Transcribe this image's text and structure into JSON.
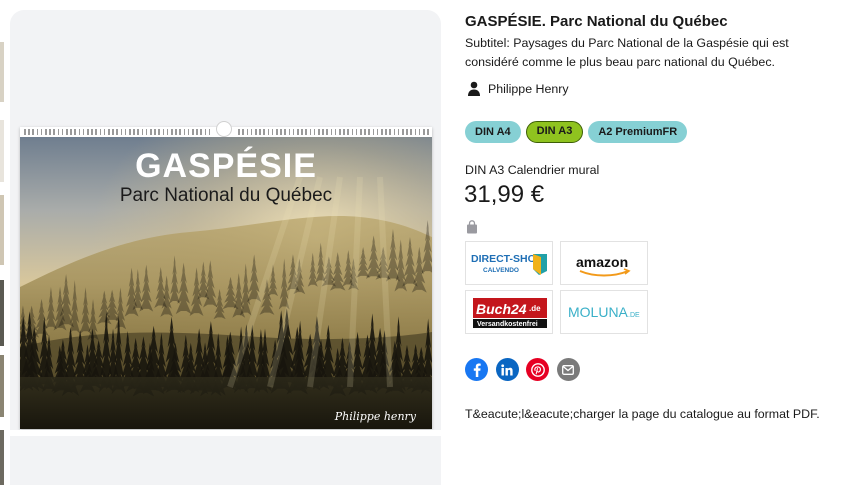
{
  "product": {
    "title": "GASPÉSIE. Parc National du Québec",
    "subtitle": "Subtitel: Paysages du Parc National de la Gaspésie qui est considéré comme le plus beau parc national du Québec.",
    "author": "Philippe Henry",
    "author_icon": "person-icon"
  },
  "calendar_image": {
    "title": "GASPÉSIE",
    "subtitle": "Parc National du Québec",
    "signature": "Philippe henry"
  },
  "formats": [
    {
      "label": "DIN A4",
      "active": false
    },
    {
      "label": "DIN A3",
      "active": true
    },
    {
      "label": "A2 PremiumFR",
      "active": false
    }
  ],
  "selected_format_label": "DIN A3 Calendrier mural",
  "price": "31,99 €",
  "bag_icon": "shopping-bag-icon",
  "shops": [
    {
      "name": "DIRECT-SHOP",
      "sub": "CALVENDO"
    },
    {
      "name": "amazon"
    },
    {
      "name": "Buch24",
      "tld": ".de",
      "sub": "Versandkostenfrei"
    },
    {
      "name": "MOLUNA",
      "tld": ".DE"
    }
  ],
  "socials": [
    {
      "name": "facebook-icon",
      "color": "#1877f2"
    },
    {
      "name": "linkedin-icon",
      "color": "#0a66c2"
    },
    {
      "name": "pinterest-icon",
      "color": "#e60023"
    },
    {
      "name": "mail-icon",
      "color": "#7a7a7a"
    }
  ],
  "catalog_link": "T&eacute;l&eacute;charger la page du catalogue au format PDF."
}
